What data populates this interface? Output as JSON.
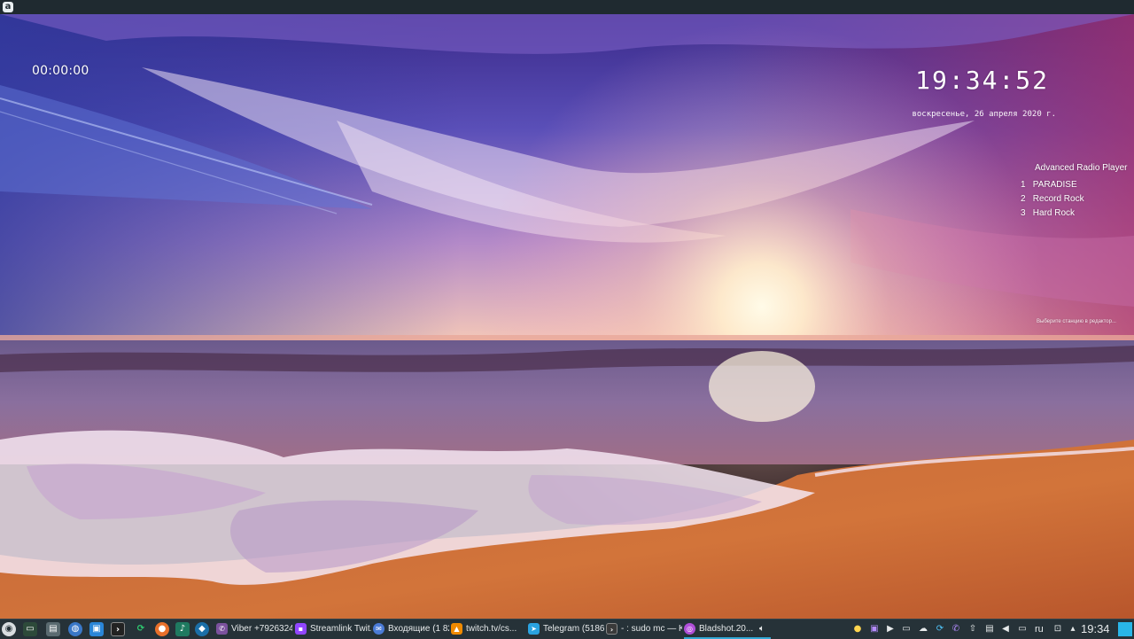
{
  "topbar": {
    "logo_glyph": "a"
  },
  "widgets": {
    "stopwatch": "00:00:00",
    "clock": "19:34:52",
    "date": "воскресенье, 26 апреля 2020 г."
  },
  "radio": {
    "title": "Advanced Radio Player",
    "stations": [
      {
        "num": "1",
        "name": "PARADISE"
      },
      {
        "num": "2",
        "name": "Record Rock"
      },
      {
        "num": "3",
        "name": "Hard Rock"
      }
    ],
    "hint": "Выберите станцию в редактор..."
  },
  "taskbar": {
    "tasks": [
      {
        "label": "Viber +7926324...",
        "icon": "viber-icon",
        "color": "#7b519d"
      },
      {
        "label": "Streamlink Twit...",
        "icon": "twitch-icon",
        "color": "#9146ff"
      },
      {
        "label": "Входящие (1 82...",
        "icon": "mail-icon",
        "color": "#4b7bd6"
      },
      {
        "label": "twitch.tv/cs...",
        "icon": "vlc-icon",
        "color": "#f08a00"
      },
      {
        "label": "Telegram (5186)",
        "icon": "telegram-icon",
        "color": "#2aa3e0"
      },
      {
        "label": "- : sudo mc — K...",
        "icon": "terminal-icon",
        "color": "#3a3a3a"
      },
      {
        "label": "Bladshot.20...",
        "icon": "image-viewer-icon",
        "color": "#b04fd9"
      }
    ],
    "language": "ru",
    "time": "19:34"
  },
  "colors": {
    "taskbar_bg": "#263238",
    "accent": "#29b6e8"
  }
}
